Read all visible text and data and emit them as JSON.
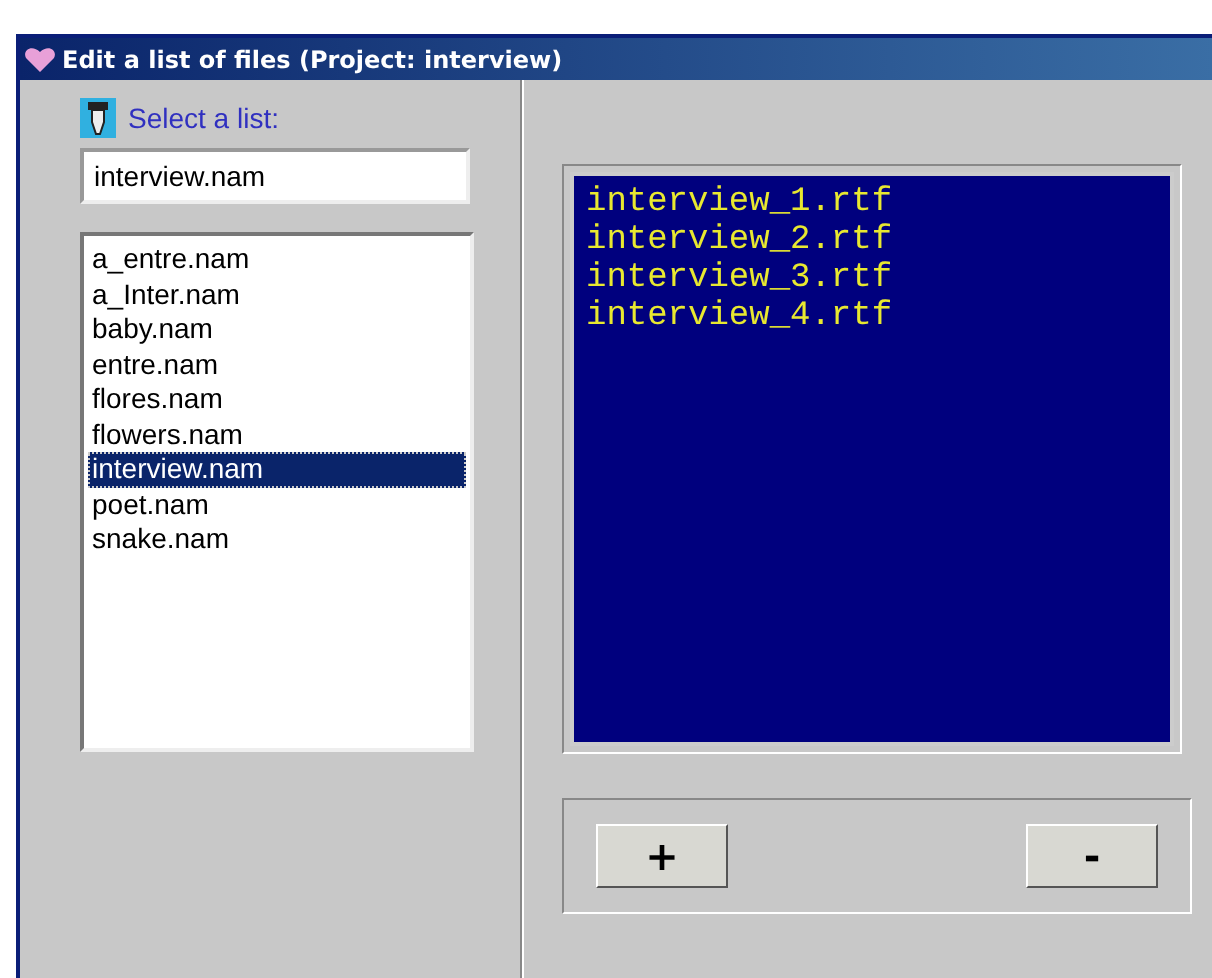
{
  "window": {
    "title": "Edit a list of files (Project: interview)"
  },
  "selector": {
    "label": "Select a list:",
    "value": "interview.nam"
  },
  "lists": [
    {
      "name": "a_entre.nam",
      "selected": false
    },
    {
      "name": "a_Inter.nam",
      "selected": false
    },
    {
      "name": "baby.nam",
      "selected": false
    },
    {
      "name": "entre.nam",
      "selected": false
    },
    {
      "name": "flores.nam",
      "selected": false
    },
    {
      "name": "flowers.nam",
      "selected": false
    },
    {
      "name": "interview.nam",
      "selected": true
    },
    {
      "name": "poet.nam",
      "selected": false
    },
    {
      "name": "snake.nam",
      "selected": false
    }
  ],
  "files": [
    "interview_1.rtf",
    "interview_2.rtf",
    "interview_3.rtf",
    "interview_4.rtf"
  ],
  "buttons": [
    "+",
    "-"
  ]
}
